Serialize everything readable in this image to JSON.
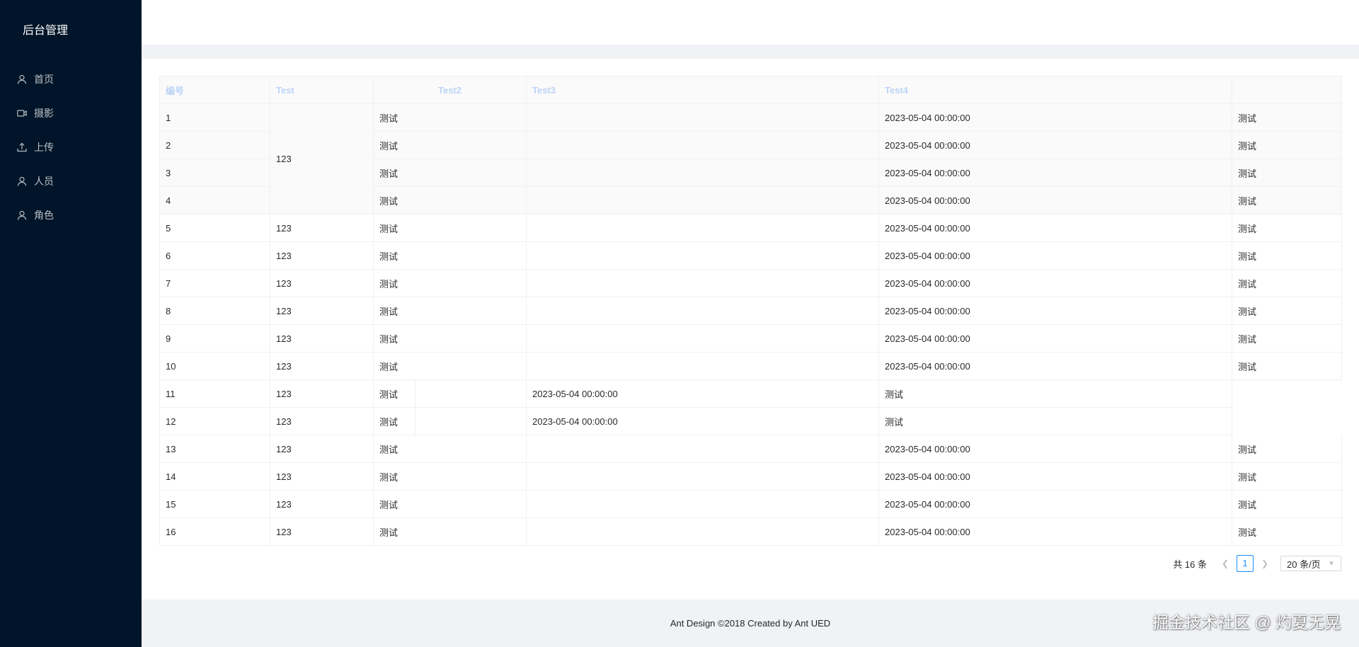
{
  "sidebar": {
    "logo": "后台管理",
    "items": [
      {
        "label": "首页",
        "icon": "user-icon"
      },
      {
        "label": "摄影",
        "icon": "video-camera-icon"
      },
      {
        "label": "上传",
        "icon": "upload-icon"
      },
      {
        "label": "人员",
        "icon": "user-icon"
      },
      {
        "label": "角色",
        "icon": "user-icon"
      }
    ]
  },
  "table": {
    "columns": [
      "编号",
      "Test",
      "Test2",
      "Test3",
      "Test4",
      ""
    ],
    "rows": [
      {
        "id": "1",
        "test": "123",
        "test2": "测试",
        "test3": "",
        "test4": "2023-05-04 00:00:00",
        "extra": "测试"
      },
      {
        "id": "2",
        "test": "",
        "test2": "测试",
        "test3": "",
        "test4": "2023-05-04 00:00:00",
        "extra": "测试"
      },
      {
        "id": "3",
        "test": "",
        "test2": "测试",
        "test3": "",
        "test4": "2023-05-04 00:00:00",
        "extra": "测试"
      },
      {
        "id": "4",
        "test": "",
        "test2": "测试",
        "test3": "",
        "test4": "2023-05-04 00:00:00",
        "extra": "测试"
      },
      {
        "id": "5",
        "test": "123",
        "test2": "测试",
        "test3": "",
        "test4": "2023-05-04 00:00:00",
        "extra": "测试"
      },
      {
        "id": "6",
        "test": "123",
        "test2": "测试",
        "test3": "",
        "test4": "2023-05-04 00:00:00",
        "extra": "测试"
      },
      {
        "id": "7",
        "test": "123",
        "test2": "测试",
        "test3": "",
        "test4": "2023-05-04 00:00:00",
        "extra": "测试"
      },
      {
        "id": "8",
        "test": "123",
        "test2": "测试",
        "test3": "",
        "test4": "2023-05-04 00:00:00",
        "extra": "测试"
      },
      {
        "id": "9",
        "test": "123",
        "test2": "测试",
        "test3": "",
        "test4": "2023-05-04 00:00:00",
        "extra": "测试"
      },
      {
        "id": "10",
        "test": "123",
        "test2": "测试",
        "test3": "",
        "test4": "2023-05-04 00:00:00",
        "extra": "测试"
      },
      {
        "id": "11",
        "test": "123",
        "test2": "测试",
        "test3": "2023-05-04 00:00:00",
        "test4": "测试",
        "extra": ""
      },
      {
        "id": "12",
        "test": "123",
        "test2": "测试",
        "test3": "2023-05-04 00:00:00",
        "test4": "测试",
        "extra": ""
      },
      {
        "id": "13",
        "test": "123",
        "test2": "测试",
        "test3": "",
        "test4": "2023-05-04 00:00:00",
        "extra": "测试"
      },
      {
        "id": "14",
        "test": "123",
        "test2": "测试",
        "test3": "",
        "test4": "2023-05-04 00:00:00",
        "extra": "测试"
      },
      {
        "id": "15",
        "test": "123",
        "test2": "测试",
        "test3": "",
        "test4": "2023-05-04 00:00:00",
        "extra": "测试"
      },
      {
        "id": "16",
        "test": "123",
        "test2": "测试",
        "test3": "",
        "test4": "2023-05-04 00:00:00",
        "extra": "测试"
      }
    ]
  },
  "pagination": {
    "total": "共 16 条",
    "current": "1",
    "page_size": "20 条/页"
  },
  "footer": {
    "text": "Ant Design ©2018 Created by Ant UED"
  },
  "watermark": "掘金技术社区 @ 灼夏无晃"
}
